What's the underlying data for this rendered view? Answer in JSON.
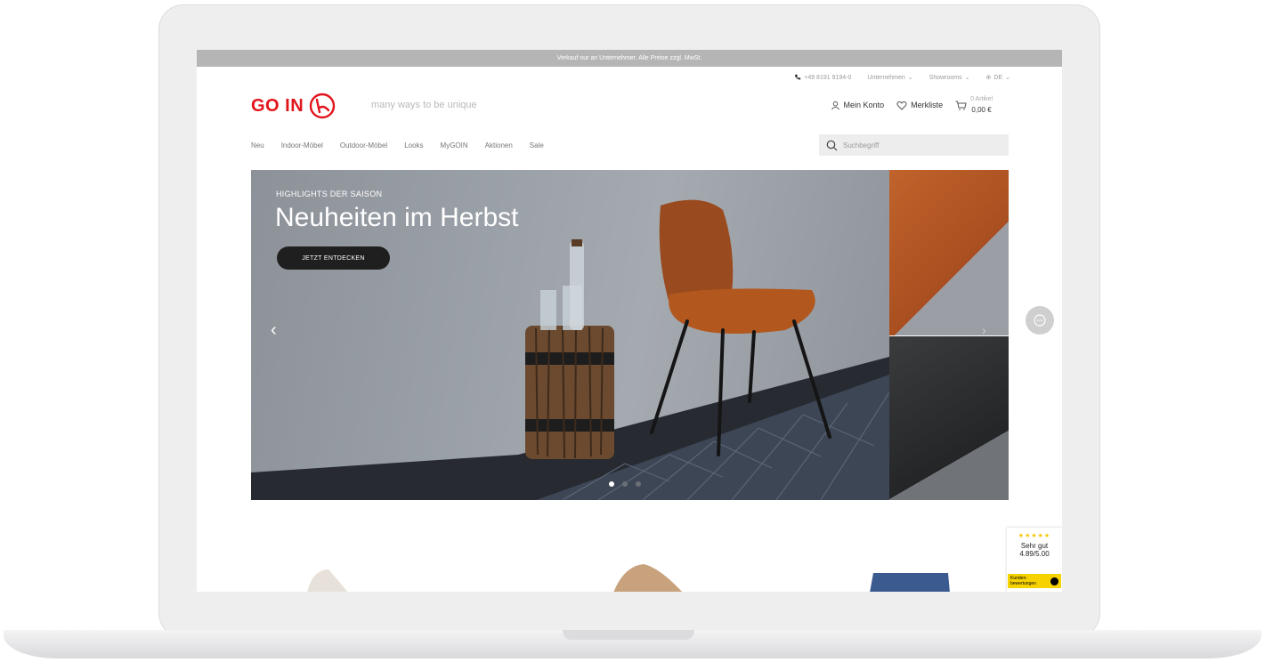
{
  "announcement": "Verkauf nur an Unternehmer. Alle Preise zzgl. MwSt.",
  "util": {
    "phone": "+49 8191 9194-0",
    "company": "Unternehmen",
    "showrooms": "Showrooms",
    "language": "DE"
  },
  "brand": {
    "logo_text": "GO IN",
    "tagline": "many ways to be unique",
    "color": "#e2141b"
  },
  "account": {
    "my_account": "Mein Konto",
    "wishlist": "Merkliste",
    "cart_count": "0 Artikel",
    "cart_total": "0,00 €"
  },
  "nav": [
    "Neu",
    "Indoor-Möbel",
    "Outdoor-Möbel",
    "Looks",
    "MyGOIN",
    "Aktionen",
    "Sale"
  ],
  "search": {
    "placeholder": "Suchbegriff"
  },
  "hero": {
    "kicker": "HIGHLIGHTS DER SAISON",
    "title": "Neuheiten im Herbst",
    "button": "JETZT ENTDECKEN",
    "slides": 3,
    "active_slide": 1
  },
  "rating": {
    "stars": "★★★★★",
    "label": "Sehr gut",
    "score": "4.89/5.00",
    "badge": "Kunden-bewertungen"
  },
  "icons": {
    "phone": "phone-icon",
    "user": "user-icon",
    "heart": "heart-icon",
    "cart": "cart-icon",
    "search": "search-icon",
    "globe": "globe-icon",
    "chat": "chat-icon"
  }
}
